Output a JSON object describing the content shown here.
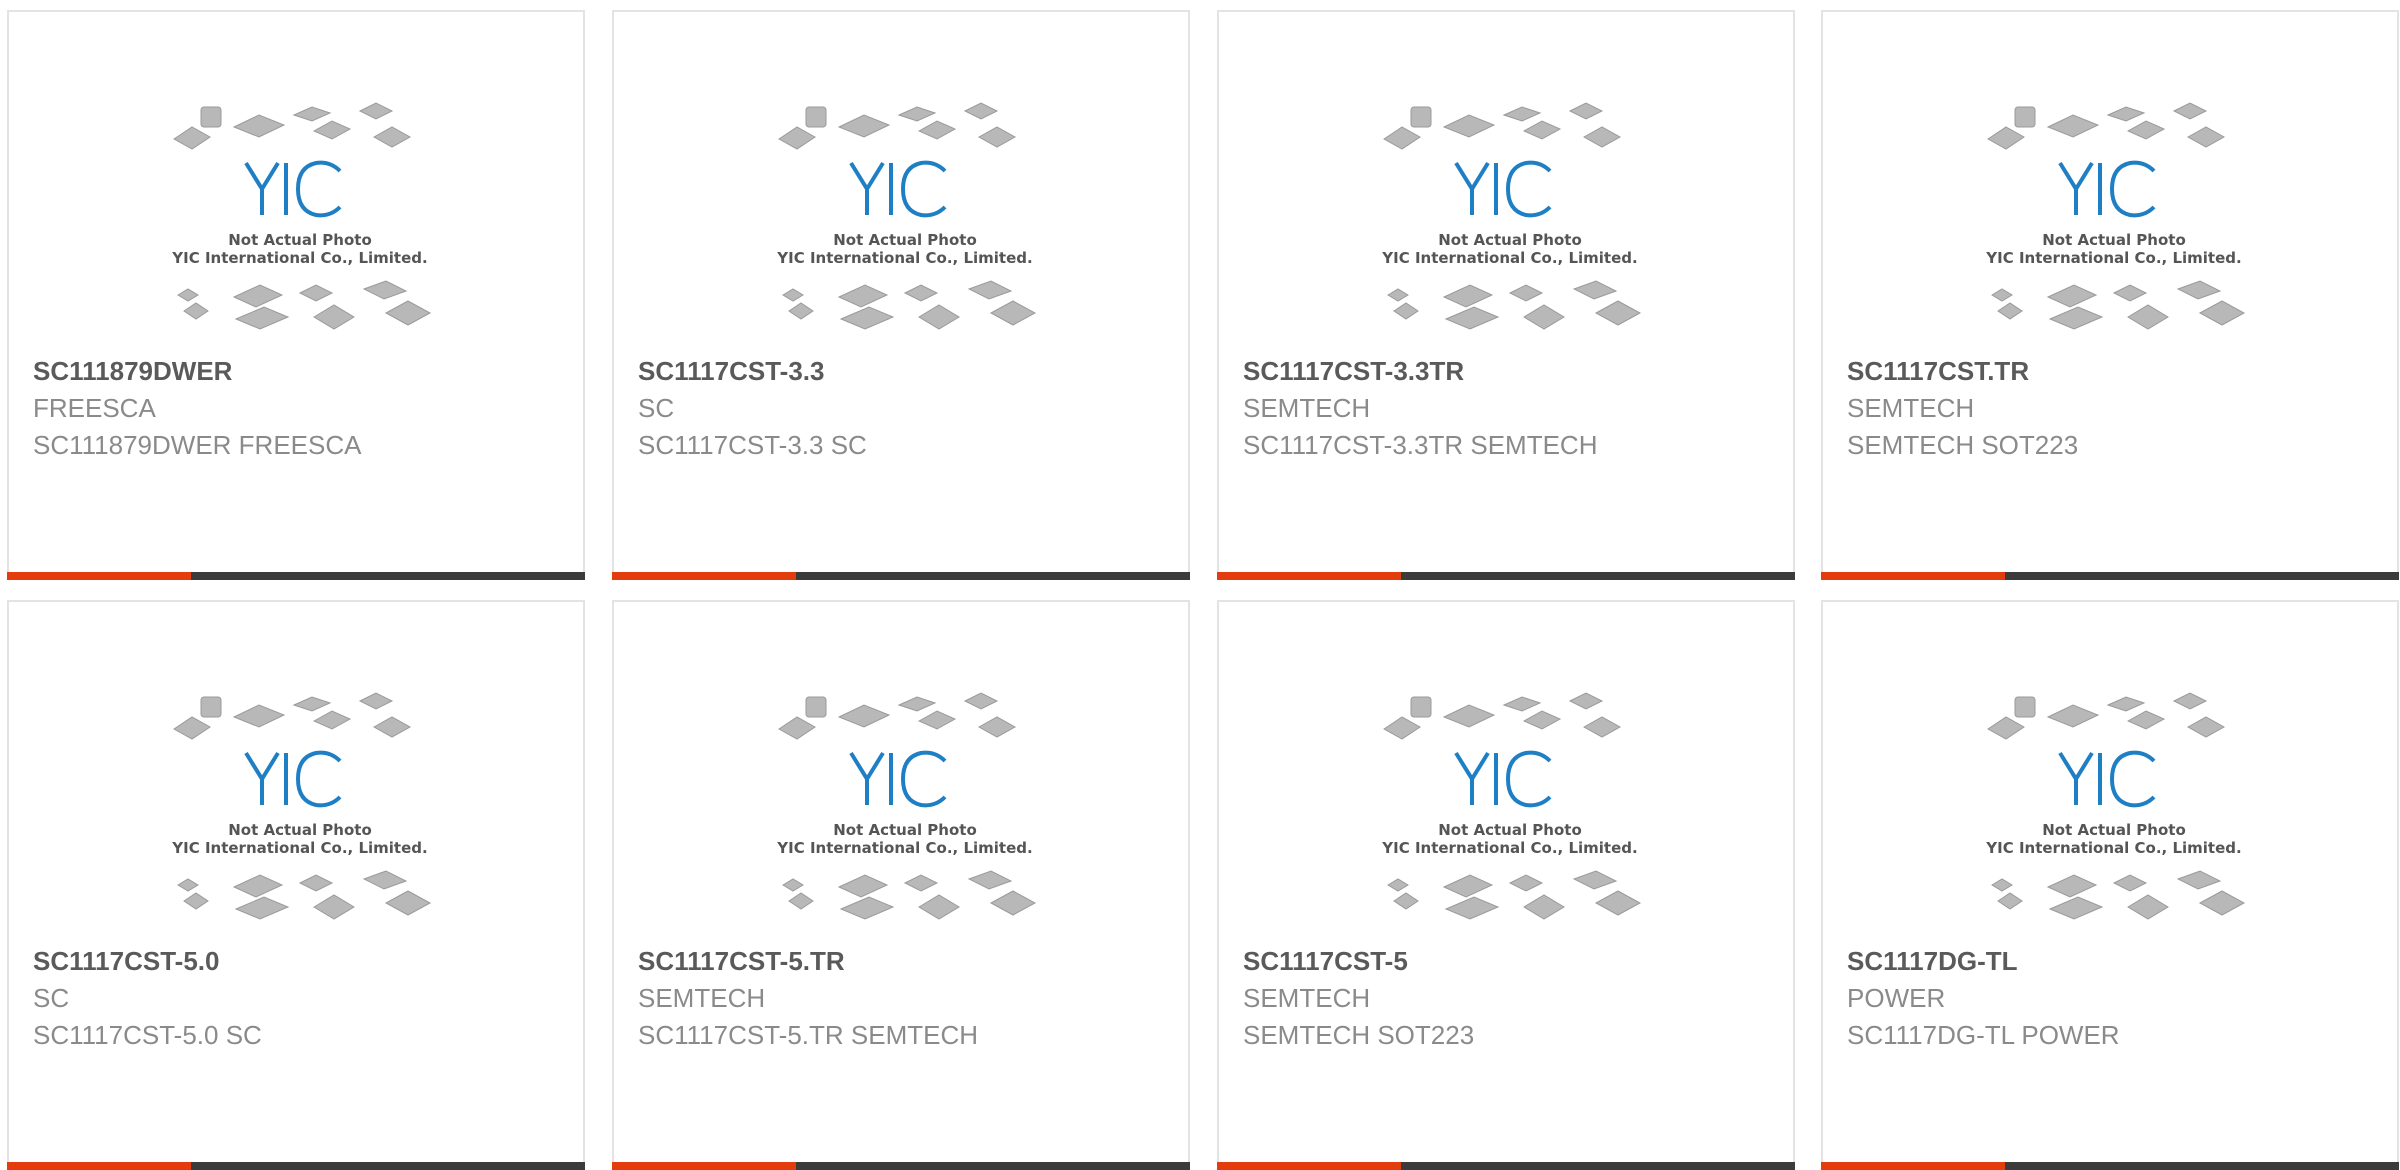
{
  "placeholder": {
    "logo_text": "YIC",
    "line1": "Not Actual Photo",
    "line2": "YIC International Co., Limited."
  },
  "colors": {
    "accent": "#e33c0d",
    "bar_dark": "#3b3b3b",
    "logo_blue": "#1f7fc4",
    "chip_gray": "#b0b0b0"
  },
  "products": [
    {
      "name": "SC111879DWER",
      "maker": "FREESCA",
      "desc": "SC111879DWER FREESCA"
    },
    {
      "name": "SC1117CST-3.3",
      "maker": "SC",
      "desc": "SC1117CST-3.3 SC"
    },
    {
      "name": "SC1117CST-3.3TR",
      "maker": "SEMTECH",
      "desc": "SC1117CST-3.3TR SEMTECH"
    },
    {
      "name": "SC1117CST.TR",
      "maker": "SEMTECH",
      "desc": "SEMTECH SOT223"
    },
    {
      "name": "SC1117CST-5.0",
      "maker": "SC",
      "desc": "SC1117CST-5.0 SC"
    },
    {
      "name": "SC1117CST-5.TR",
      "maker": "SEMTECH",
      "desc": "SC1117CST-5.TR SEMTECH"
    },
    {
      "name": "SC1117CST-5",
      "maker": "SEMTECH",
      "desc": "SEMTECH SOT223"
    },
    {
      "name": "SC1117DG-TL",
      "maker": "POWER",
      "desc": "SC1117DG-TL POWER"
    }
  ]
}
